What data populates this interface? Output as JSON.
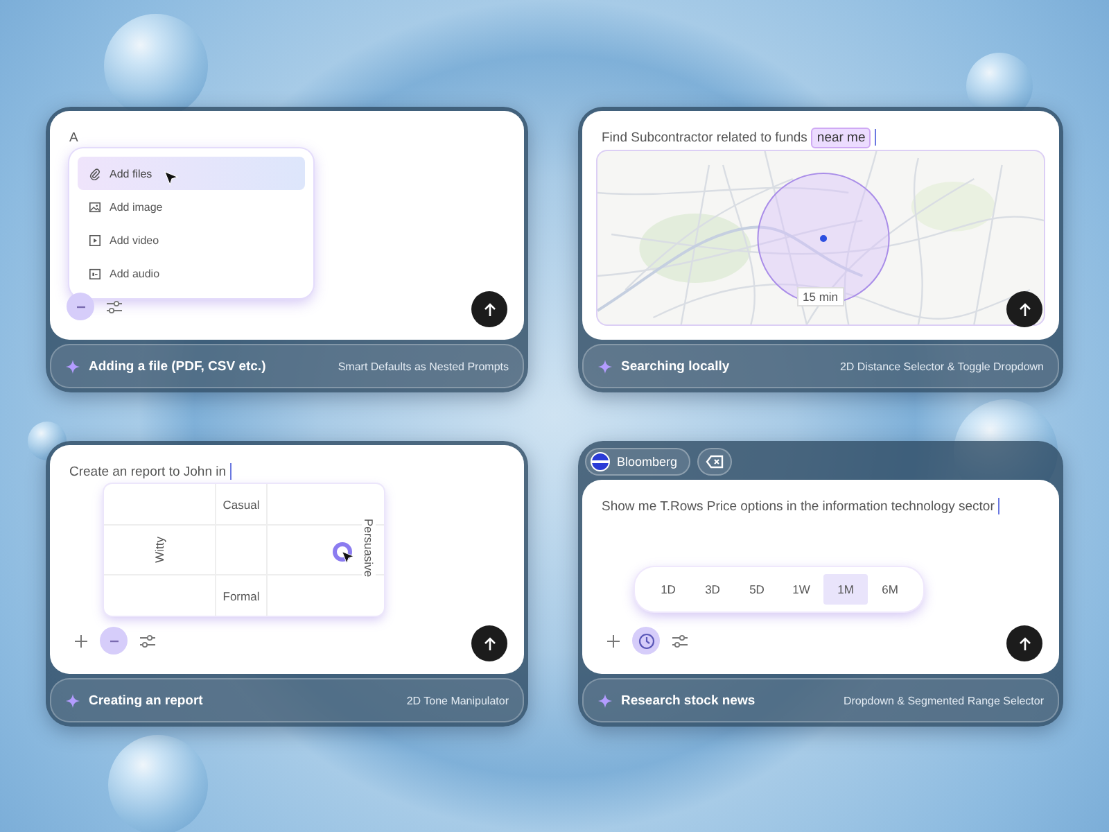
{
  "cards": [
    {
      "kind": "menu",
      "prompt": "A",
      "menu": [
        {
          "label": "Add files",
          "selected": true
        },
        {
          "label": "Add image",
          "selected": false
        },
        {
          "label": "Add video",
          "selected": false
        },
        {
          "label": "Add audio",
          "selected": false
        }
      ],
      "tools": [
        {
          "kind": "minus",
          "selected": true
        },
        {
          "kind": "sliders",
          "selected": false
        }
      ],
      "footer": {
        "title": "Adding a file (PDF, CSV etc.)",
        "subtitle": "Smart Defaults as Nested Prompts"
      }
    },
    {
      "kind": "map",
      "prompt": "Find Subcontractor related to funds",
      "chip": "near me",
      "map_label": "15 min",
      "footer": {
        "title": "Searching locally",
        "subtitle": "2D Distance Selector & Toggle Dropdown"
      }
    },
    {
      "kind": "tone",
      "prompt": "Create an report to John in",
      "axes": {
        "top": "Casual",
        "bottom": "Formal",
        "left": "Witty",
        "right": "Persuasive"
      },
      "tools": [
        {
          "kind": "plus",
          "selected": false
        },
        {
          "kind": "minus",
          "selected": true
        },
        {
          "kind": "sliders",
          "selected": false
        }
      ],
      "footer": {
        "title": "Creating an report",
        "subtitle": "2D Tone Manipulator"
      }
    },
    {
      "kind": "range",
      "source": "Bloomberg",
      "prompt": "Show me T.Rows Price options in the information technology sector",
      "ranges": [
        {
          "label": "1D",
          "selected": false
        },
        {
          "label": "3D",
          "selected": false
        },
        {
          "label": "5D",
          "selected": false
        },
        {
          "label": "1W",
          "selected": false
        },
        {
          "label": "1M",
          "selected": true
        },
        {
          "label": "6M",
          "selected": false
        }
      ],
      "tools": [
        {
          "kind": "plus",
          "selected": false
        },
        {
          "kind": "clock",
          "selected": true
        },
        {
          "kind": "sliders",
          "selected": false
        }
      ],
      "footer": {
        "title": "Research stock news",
        "subtitle": "Dropdown & Segmented Range Selector"
      }
    }
  ]
}
